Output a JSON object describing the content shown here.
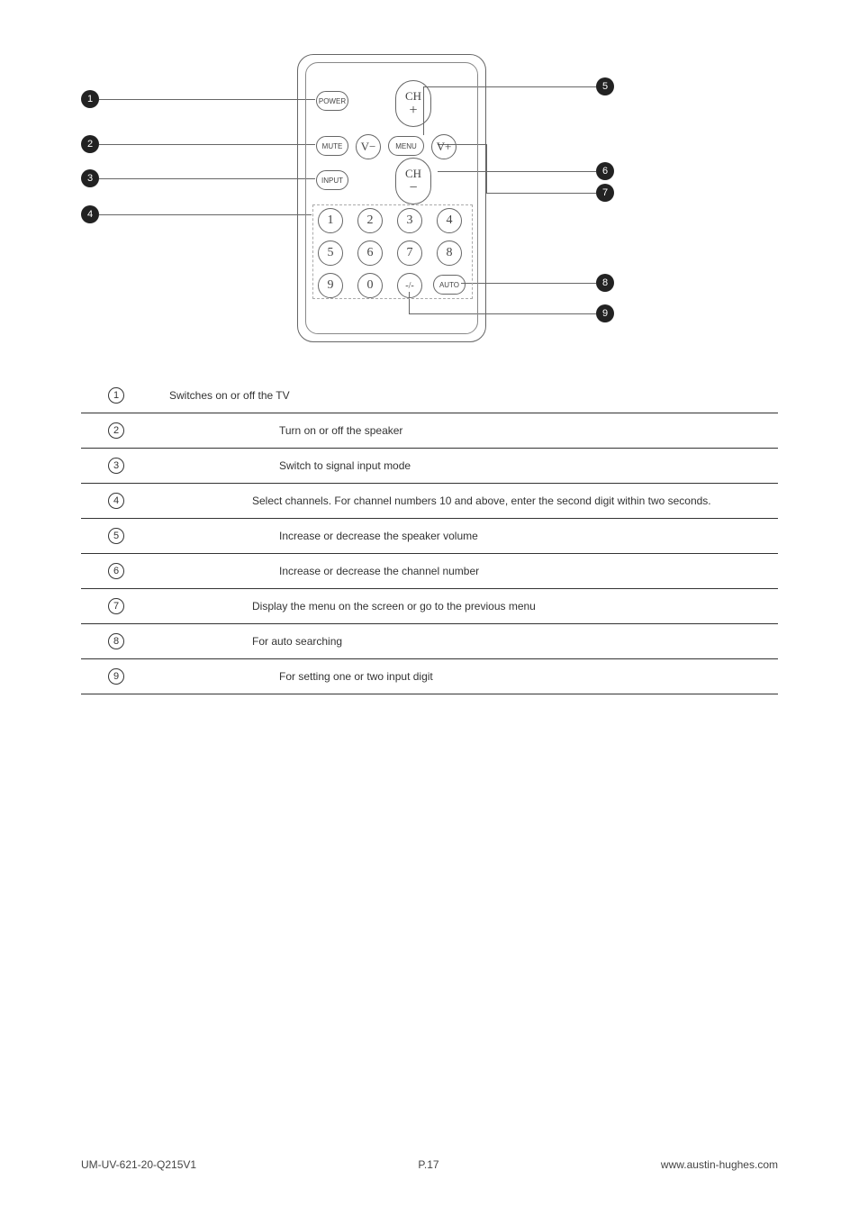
{
  "remote": {
    "power": "POWER",
    "mute": "MUTE",
    "input": "INPUT",
    "menu": "MENU",
    "auto": "AUTO",
    "ch": "CH",
    "v_minus": "V−",
    "v_plus": "V+",
    "dash": "-/-",
    "digits": [
      "1",
      "2",
      "3",
      "4",
      "5",
      "6",
      "7",
      "8",
      "9",
      "0"
    ]
  },
  "callouts_left": [
    "1",
    "2",
    "3",
    "4"
  ],
  "callouts_right": [
    "5",
    "6",
    "7",
    "8",
    "9"
  ],
  "descriptions": [
    {
      "n": "1",
      "text": "Switches on or off the TV"
    },
    {
      "n": "2",
      "text": "Turn on or off the speaker"
    },
    {
      "n": "3",
      "text": "Switch to signal input mode"
    },
    {
      "n": "4",
      "text": "Select channels. For channel numbers 10 and above, enter the second digit within two seconds."
    },
    {
      "n": "5",
      "text": "Increase or decrease the speaker volume"
    },
    {
      "n": "6",
      "text": "Increase or decrease the channel number"
    },
    {
      "n": "7",
      "text": "Display the menu on the screen or go to the previous menu"
    },
    {
      "n": "8",
      "text": "For auto searching"
    },
    {
      "n": "9",
      "text": "For setting one or two input digit"
    }
  ],
  "footer": {
    "left": "UM-UV-621-20-Q215V1",
    "center": "P.17",
    "right": "www.austin-hughes.com"
  }
}
